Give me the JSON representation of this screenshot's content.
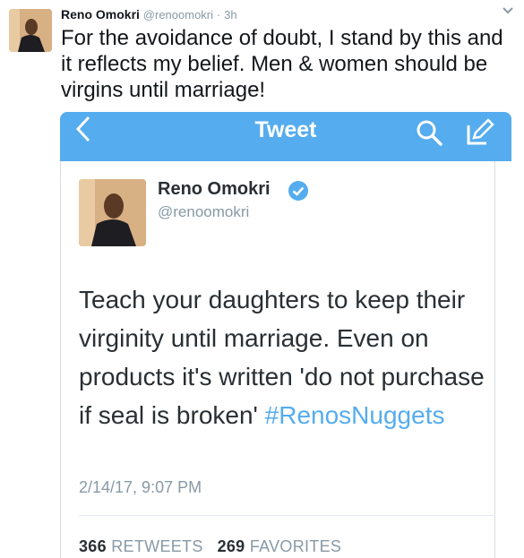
{
  "outer": {
    "name": "Reno Omokri",
    "handle": "@renoomokri",
    "separator": "·",
    "time": "3h",
    "text": "For the avoidance of doubt, I stand by this and it reflects my belief. Men & women should be virgins until marriage!",
    "caret_icon": "chevron-down-icon"
  },
  "screenshot": {
    "nav": {
      "title": "Tweet",
      "back_icon": "back-chevron-icon",
      "search_icon": "search-icon",
      "compose_icon": "compose-icon",
      "color": "#55acee"
    },
    "tweet": {
      "name": "Reno Omokri",
      "handle": "@renoomokri",
      "text": "Teach your daughters to keep their virginity until marriage. Even on products it's written 'do not purchase if seal is broken'",
      "hashtag": "#RenosNuggets",
      "date": "2/14/17, 9:07 PM",
      "retweets_count": "366",
      "retweets_label": "RETWEETS",
      "favorites_count": "269",
      "favorites_label": "FAVORITES"
    }
  },
  "colors": {
    "accent": "#55acee",
    "muted": "#8899a6",
    "text": "#14171a"
  }
}
